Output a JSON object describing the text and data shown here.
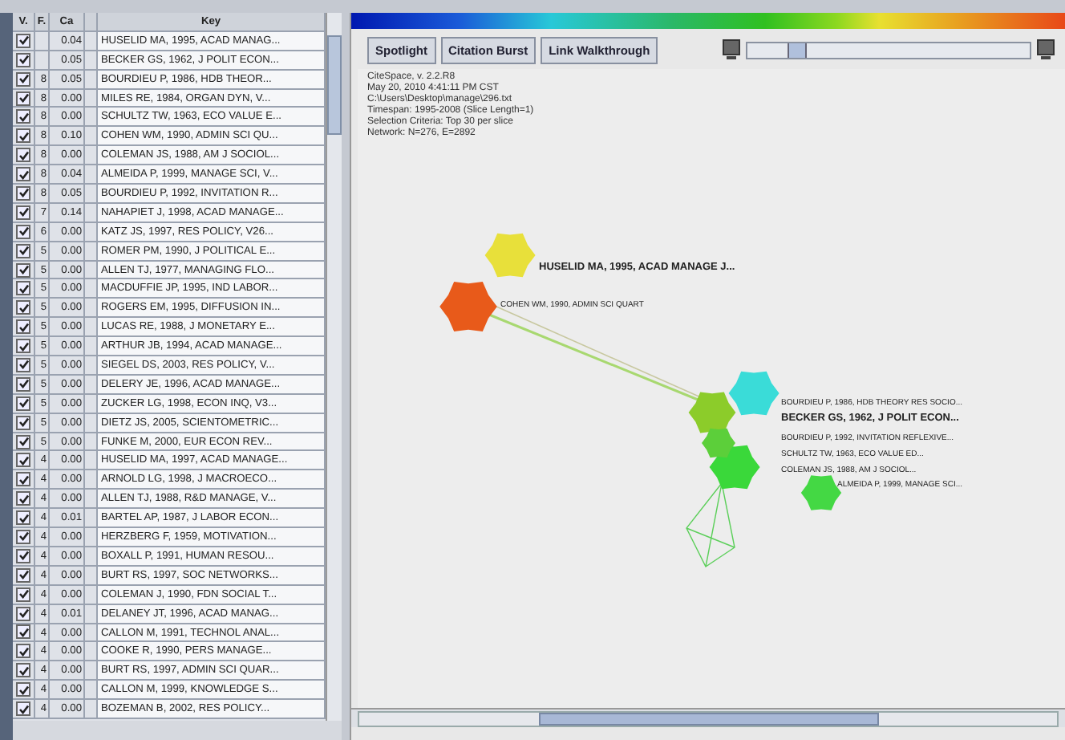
{
  "table": {
    "columns": [
      "V.",
      "F.",
      "Ca",
      "Key"
    ],
    "rows": [
      {
        "checked": true,
        "f": "",
        "ca": "0.04",
        "key": "HUSELID MA, 1995, ACAD MANAG..."
      },
      {
        "checked": true,
        "f": "",
        "ca": "0.05",
        "key": "BECKER GS, 1962, J POLIT ECON..."
      },
      {
        "checked": true,
        "f": "8",
        "ca": "0.05",
        "key": "BOURDIEU P, 1986, HDB THEOR..."
      },
      {
        "checked": true,
        "f": "8",
        "ca": "0.00",
        "key": "MILES RE, 1984, ORGAN DYN, V..."
      },
      {
        "checked": true,
        "f": "8",
        "ca": "0.00",
        "key": "SCHULTZ TW, 1963, ECO VALUE E..."
      },
      {
        "checked": true,
        "f": "8",
        "ca": "0.10",
        "key": "COHEN WM, 1990, ADMIN SCI QU..."
      },
      {
        "checked": true,
        "f": "8",
        "ca": "0.00",
        "key": "COLEMAN JS, 1988, AM J SOCIOL..."
      },
      {
        "checked": true,
        "f": "8",
        "ca": "0.04",
        "key": "ALMEIDA P, 1999, MANAGE SCI, V..."
      },
      {
        "checked": true,
        "f": "8",
        "ca": "0.05",
        "key": "BOURDIEU P, 1992, INVITATION R..."
      },
      {
        "checked": true,
        "f": "7",
        "ca": "0.14",
        "key": "NAHAPIET J, 1998, ACAD MANAGE..."
      },
      {
        "checked": true,
        "f": "6",
        "ca": "0.00",
        "key": "KATZ JS, 1997, RES POLICY, V26..."
      },
      {
        "checked": true,
        "f": "5",
        "ca": "0.00",
        "key": "ROMER PM, 1990, J POLITICAL E..."
      },
      {
        "checked": true,
        "f": "5",
        "ca": "0.00",
        "key": "ALLEN TJ, 1977, MANAGING FLO..."
      },
      {
        "checked": true,
        "f": "5",
        "ca": "0.00",
        "key": "MACDUFFIE JP, 1995, IND LABOR..."
      },
      {
        "checked": true,
        "f": "5",
        "ca": "0.00",
        "key": "ROGERS EM, 1995, DIFFUSION IN..."
      },
      {
        "checked": true,
        "f": "5",
        "ca": "0.00",
        "key": "LUCAS RE, 1988, J MONETARY E..."
      },
      {
        "checked": true,
        "f": "5",
        "ca": "0.00",
        "key": "ARTHUR JB, 1994, ACAD MANAGE..."
      },
      {
        "checked": true,
        "f": "5",
        "ca": "0.00",
        "key": "SIEGEL DS, 2003, RES POLICY, V..."
      },
      {
        "checked": true,
        "f": "5",
        "ca": "0.00",
        "key": "DELERY JE, 1996, ACAD MANAGE..."
      },
      {
        "checked": true,
        "f": "5",
        "ca": "0.00",
        "key": "ZUCKER LG, 1998, ECON INQ, V3..."
      },
      {
        "checked": true,
        "f": "5",
        "ca": "0.00",
        "key": "DIETZ JS, 2005, SCIENTOMETRIC..."
      },
      {
        "checked": true,
        "f": "5",
        "ca": "0.00",
        "key": "FUNKE M, 2000, EUR ECON REV..."
      },
      {
        "checked": true,
        "f": "4",
        "ca": "0.00",
        "key": "HUSELID MA, 1997, ACAD MANAGE..."
      },
      {
        "checked": true,
        "f": "4",
        "ca": "0.00",
        "key": "ARNOLD LG, 1998, J MACROECO..."
      },
      {
        "checked": true,
        "f": "4",
        "ca": "0.00",
        "key": "ALLEN TJ, 1988, R&D MANAGE, V..."
      },
      {
        "checked": true,
        "f": "4",
        "ca": "0.01",
        "key": "BARTEL AP, 1987, J LABOR ECON..."
      },
      {
        "checked": true,
        "f": "4",
        "ca": "0.00",
        "key": "HERZBERG F, 1959, MOTIVATION..."
      },
      {
        "checked": true,
        "f": "4",
        "ca": "0.00",
        "key": "BOXALL P, 1991, HUMAN RESOU..."
      },
      {
        "checked": true,
        "f": "4",
        "ca": "0.00",
        "key": "BURT RS, 1997, SOC NETWORKS..."
      },
      {
        "checked": true,
        "f": "4",
        "ca": "0.00",
        "key": "COLEMAN J, 1990, FDN SOCIAL T..."
      },
      {
        "checked": true,
        "f": "4",
        "ca": "0.01",
        "key": "DELANEY JT, 1996, ACAD MANAG..."
      },
      {
        "checked": true,
        "f": "4",
        "ca": "0.00",
        "key": "CALLON M, 1991, TECHNOL ANAL..."
      },
      {
        "checked": true,
        "f": "4",
        "ca": "0.00",
        "key": "COOKE R, 1990, PERS MANAGE..."
      },
      {
        "checked": true,
        "f": "4",
        "ca": "0.00",
        "key": "BURT RS, 1997, ADMIN SCI QUAR..."
      },
      {
        "checked": true,
        "f": "4",
        "ca": "0.00",
        "key": "CALLON M, 1999, KNOWLEDGE S..."
      },
      {
        "checked": true,
        "f": "4",
        "ca": "0.00",
        "key": "BOZEMAN B, 2002, RES POLICY..."
      }
    ]
  },
  "toolbar": {
    "buttons": [
      "Spotlight",
      "Citation Burst",
      "Link Walkthrough"
    ],
    "zoom_slider": {
      "level": 0.15
    }
  },
  "info_lines": [
    "CiteSpace, v. 2.2.R8",
    "May 20, 2010 4:41:11 PM CST",
    "C:\\Users\\Desktop\\manage\\296.txt",
    "Timespan: 1995-2008 (Slice Length=1)",
    "Selection Criteria: Top 30 per slice",
    "Network: N=276, E=2892"
  ],
  "node_labels": [
    {
      "text": "HUSELID MA, 1995, ACAD MANAGE J...",
      "bold": true
    },
    {
      "text": "COHEN WM, 1990, ADMIN SCI QUART",
      "bold": false
    },
    {
      "text": "BOURDIEU P, 1986, HDB THEORY RES SOCIO...",
      "bold": false
    },
    {
      "text": "BECKER GS, 1962, J POLIT ECON...",
      "bold": true
    },
    {
      "text": "BOURDIEU P, 1992, INVITATION REFLEXIVE...",
      "bold": false
    },
    {
      "text": "SCHULTZ TW, 1963, ECO VALUE ED...",
      "bold": false
    },
    {
      "text": "COLEMAN JS, 1988, AM J SOCIOL...",
      "bold": false
    },
    {
      "text": "ALMEIDA P, 1999, MANAGE SCI...",
      "bold": false
    }
  ]
}
